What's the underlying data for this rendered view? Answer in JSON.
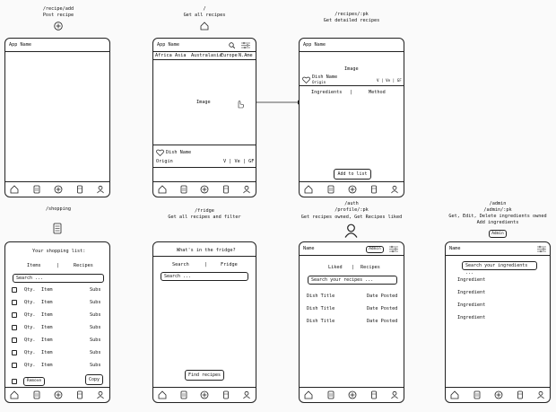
{
  "add": {
    "route": "/recipe/add",
    "desc": "Post recipe",
    "app_name": "App Name"
  },
  "home": {
    "route": "/",
    "desc": "Get all recipes",
    "app_name": "App Name",
    "tabs": [
      "Africa",
      "Asia",
      "Australasia",
      "Europe",
      "N.Ame"
    ],
    "image": "Image",
    "dish": "Dish Name",
    "origin": "Origin",
    "tags": "V | Ve | GF"
  },
  "detail": {
    "route": "/recipes/:pk",
    "desc": "Get detailed recipes",
    "app_name": "App Name",
    "image": "Image",
    "dish": "Dish Name",
    "origin": "Origin",
    "tags": "V | Ve | GF",
    "tab1": "Ingredients",
    "sep": "|",
    "tab2": "Method",
    "add_btn": "Add to list"
  },
  "shopping": {
    "route": "/shopping",
    "title": "Your shopping list:",
    "tab1": "Items",
    "sep": "|",
    "tab2": "Recipes",
    "search": "Search ...",
    "qty": "Qty.",
    "item": "Item",
    "subs": "Subs",
    "remove": "Remove",
    "copy": "Copy"
  },
  "fridge": {
    "route": "/fridge",
    "desc": "Get all recipes and filter",
    "title": "What's in the fridge?",
    "tab1": "Search",
    "sep": "|",
    "tab2": "Fridge",
    "search": "Search ...",
    "find": "Find recipes"
  },
  "profile": {
    "route": "/auth\n/profile/:pk",
    "desc": "Get recipes owned, Get Recipes liked",
    "name": "Name",
    "admin": "Admin",
    "tab1": "Liked",
    "sep": "|",
    "tab2": "Recipes",
    "search": "Search your recipes ...",
    "dish_title": "Dish Title",
    "date": "Date Posted"
  },
  "admin": {
    "route": "/admin\n/admin/:pk",
    "desc": "Get, Edit, Delete ingredients owned\nAdd ingredients",
    "badge": "Admin",
    "name": "Name",
    "search": "Search your ingredients ...",
    "ingredient": "Ingredient"
  }
}
